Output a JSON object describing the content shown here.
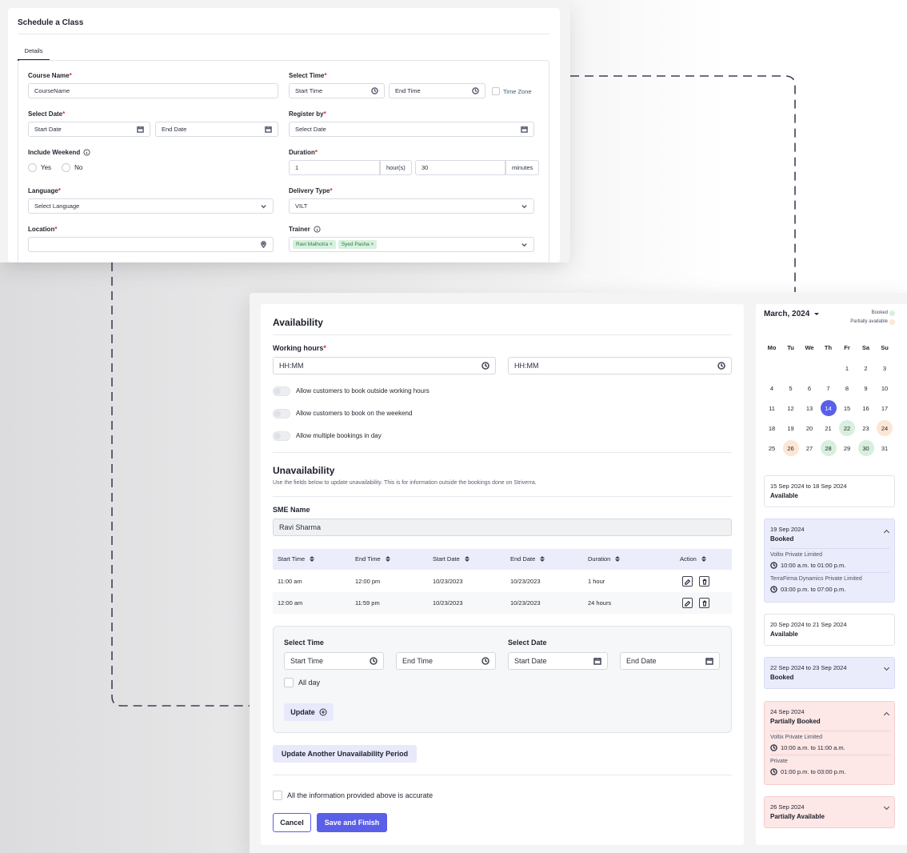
{
  "schedule": {
    "title": "Schedule a Class",
    "tab": "Details",
    "course_name": {
      "label": "Course Name",
      "value": "CourseName"
    },
    "select_time": {
      "label": "Select Time",
      "start": "Start Time",
      "end": "End Time",
      "timezone": "Time Zone"
    },
    "select_date": {
      "label": "Select Date",
      "start": "Start Date",
      "end": "End Date"
    },
    "register_by": {
      "label": "Register by",
      "placeholder": "Select Date"
    },
    "include_weekend": {
      "label": "Include Weekend",
      "yes": "Yes",
      "no": "No"
    },
    "duration": {
      "label": "Duration",
      "hours": "1",
      "hours_unit": "hour(s)",
      "minutes": "30",
      "minutes_unit": "minutes"
    },
    "language": {
      "label": "Language",
      "placeholder": "Select Language"
    },
    "delivery_type": {
      "label": "Delivery Type",
      "value": "VILT"
    },
    "location": {
      "label": "Location",
      "value": ""
    },
    "trainer": {
      "label": "Trainer",
      "chips": [
        "Ravi Malhotra ×",
        "Syed Pasha ×"
      ]
    },
    "required_mark": "*"
  },
  "availability": {
    "title": "Availability",
    "working_hours": {
      "label": "Working hours",
      "start": "HH:MM",
      "end": "HH:MM"
    },
    "toggles": [
      "Allow customers to book outside working hours",
      "Allow customers to book on the weekend",
      "Allow multiple bookings in day"
    ],
    "unavailability": {
      "title": "Unavailability",
      "description": "Use the fields below to update unavailability. This is for information outside the bookings done on Striverra."
    },
    "sme": {
      "label": "SME Name",
      "value": "Ravi Sharma"
    },
    "table": {
      "headers": [
        "Start Time",
        "End Time",
        "Start Date",
        "End Date",
        "Duration",
        "Action"
      ],
      "rows": [
        [
          "11:00 am",
          "12:00 pm",
          "10/23/2023",
          "10/23/2023",
          "1 hour"
        ],
        [
          "12:00 am",
          "11:59 pm",
          "10/23/2023",
          "10/23/2023",
          "24 hours"
        ]
      ]
    },
    "form": {
      "select_time": "Select Time",
      "select_date": "Select Date",
      "start_time": "Start Time",
      "end_time": "End Time",
      "start_date": "Start Date",
      "end_date": "End Date",
      "all_day": "All day",
      "update": "Update"
    },
    "another": "Update Another Unavailability Period",
    "accurate": "All the information provided above is accurate",
    "cancel": "Cancel",
    "save": "Save and Finish"
  },
  "calendar": {
    "month": "March, 2024",
    "legend": {
      "booked": "Booked",
      "partial": "Partially available"
    },
    "weekdays": [
      "Mo",
      "Tu",
      "We",
      "Th",
      "Fr",
      "Sa",
      "Su"
    ],
    "selected_day": 14,
    "booked_days": [
      22,
      28,
      30
    ],
    "partial_days": [
      24,
      26
    ],
    "first_weekday_index": 4,
    "days_in_month": 31,
    "colors": {
      "selected": "#5a5fe8",
      "booked": "#d6f0dd",
      "partial": "#fde6d4"
    }
  },
  "slots": [
    {
      "dates": "15 Sep 2024 to 18 Sep 2024",
      "status": "Available"
    },
    {
      "dates": "19 Sep 2024",
      "status": "Booked",
      "items": [
        {
          "org": "Voltix Private Limited",
          "time": "10:00 a.m. to 01:00 p.m."
        },
        {
          "org": "TerraFirma Dynamics Private Limited",
          "time": "03:00 p.m. to 07:00 p.m."
        }
      ]
    },
    {
      "dates": "20 Sep 2024 to 21 Sep 2024",
      "status": "Available"
    },
    {
      "dates": "22 Sep 2024 to 23 Sep 2024",
      "status": "Booked"
    },
    {
      "dates": "24 Sep 2024",
      "status": "Partially Booked",
      "items": [
        {
          "org": "Voltix Private Limited",
          "time": "10:00 a.m. to 11:00 a.m."
        },
        {
          "org": "Private",
          "time": "01:00 p.m. to 03:00 p.m."
        }
      ]
    },
    {
      "dates": "26 Sep 2024",
      "status": "Partially Available"
    }
  ]
}
